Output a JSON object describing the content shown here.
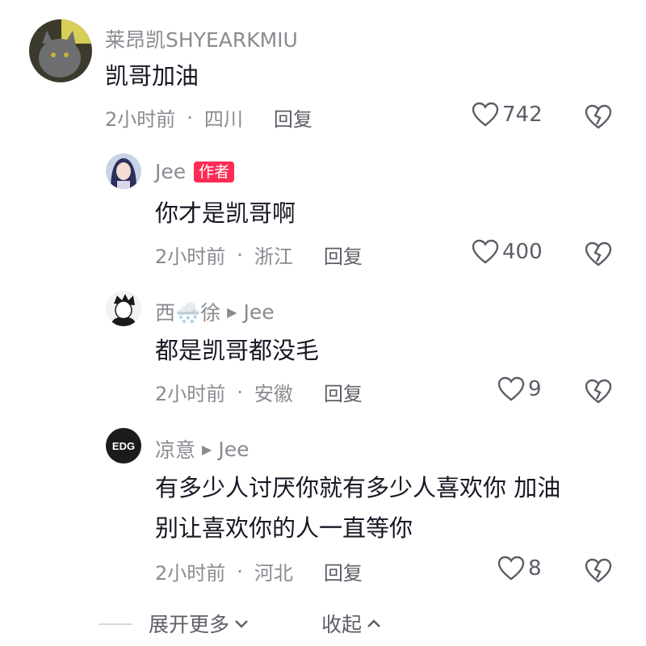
{
  "comments": [
    {
      "name": "莱昂凯SHYEARKMIU",
      "text": "凯哥加油",
      "time": "2小时前",
      "location": "四川",
      "reply_label": "回复",
      "likes": "742"
    },
    {
      "name": "Jee",
      "badge": "作者",
      "text": "你才是凯哥啊",
      "time": "2小时前",
      "location": "浙江",
      "reply_label": "回复",
      "likes": "400"
    },
    {
      "name": "西🌨️徐",
      "reply_to": "Jee",
      "text": "都是凯哥都没毛",
      "time": "2小时前",
      "location": "安徽",
      "reply_label": "回复",
      "likes": "9"
    },
    {
      "name": "凉意",
      "reply_to": "Jee",
      "avatar_text": "EDG",
      "text_line1": "有多少人讨厌你就有多少人喜欢你 加油",
      "text_line2": "别让喜欢你的人一直等你",
      "time": "2小时前",
      "location": "河北",
      "reply_label": "回复",
      "likes": "8"
    }
  ],
  "footer": {
    "expand_label": "展开更多",
    "collapse_label": "收起"
  },
  "colors": {
    "badge": "#fe2c55",
    "secondary_text": "#8a8b91"
  }
}
